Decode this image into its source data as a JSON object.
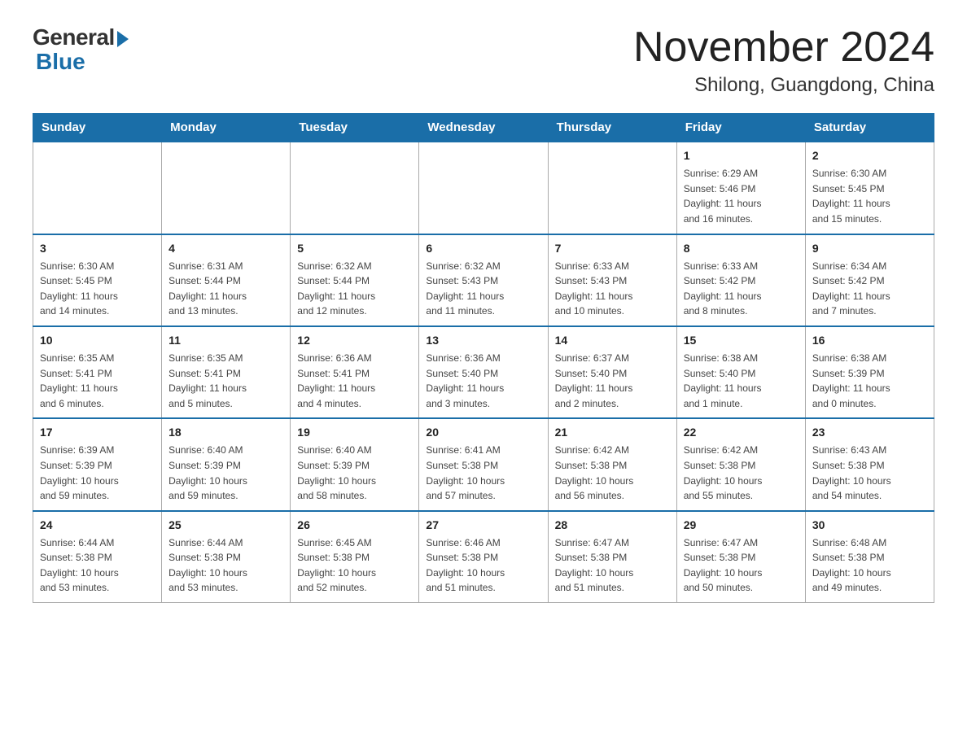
{
  "header": {
    "logo_general": "General",
    "logo_blue": "Blue",
    "month_title": "November 2024",
    "location": "Shilong, Guangdong, China"
  },
  "weekdays": [
    "Sunday",
    "Monday",
    "Tuesday",
    "Wednesday",
    "Thursday",
    "Friday",
    "Saturday"
  ],
  "weeks": [
    [
      {
        "day": "",
        "info": ""
      },
      {
        "day": "",
        "info": ""
      },
      {
        "day": "",
        "info": ""
      },
      {
        "day": "",
        "info": ""
      },
      {
        "day": "",
        "info": ""
      },
      {
        "day": "1",
        "info": "Sunrise: 6:29 AM\nSunset: 5:46 PM\nDaylight: 11 hours\nand 16 minutes."
      },
      {
        "day": "2",
        "info": "Sunrise: 6:30 AM\nSunset: 5:45 PM\nDaylight: 11 hours\nand 15 minutes."
      }
    ],
    [
      {
        "day": "3",
        "info": "Sunrise: 6:30 AM\nSunset: 5:45 PM\nDaylight: 11 hours\nand 14 minutes."
      },
      {
        "day": "4",
        "info": "Sunrise: 6:31 AM\nSunset: 5:44 PM\nDaylight: 11 hours\nand 13 minutes."
      },
      {
        "day": "5",
        "info": "Sunrise: 6:32 AM\nSunset: 5:44 PM\nDaylight: 11 hours\nand 12 minutes."
      },
      {
        "day": "6",
        "info": "Sunrise: 6:32 AM\nSunset: 5:43 PM\nDaylight: 11 hours\nand 11 minutes."
      },
      {
        "day": "7",
        "info": "Sunrise: 6:33 AM\nSunset: 5:43 PM\nDaylight: 11 hours\nand 10 minutes."
      },
      {
        "day": "8",
        "info": "Sunrise: 6:33 AM\nSunset: 5:42 PM\nDaylight: 11 hours\nand 8 minutes."
      },
      {
        "day": "9",
        "info": "Sunrise: 6:34 AM\nSunset: 5:42 PM\nDaylight: 11 hours\nand 7 minutes."
      }
    ],
    [
      {
        "day": "10",
        "info": "Sunrise: 6:35 AM\nSunset: 5:41 PM\nDaylight: 11 hours\nand 6 minutes."
      },
      {
        "day": "11",
        "info": "Sunrise: 6:35 AM\nSunset: 5:41 PM\nDaylight: 11 hours\nand 5 minutes."
      },
      {
        "day": "12",
        "info": "Sunrise: 6:36 AM\nSunset: 5:41 PM\nDaylight: 11 hours\nand 4 minutes."
      },
      {
        "day": "13",
        "info": "Sunrise: 6:36 AM\nSunset: 5:40 PM\nDaylight: 11 hours\nand 3 minutes."
      },
      {
        "day": "14",
        "info": "Sunrise: 6:37 AM\nSunset: 5:40 PM\nDaylight: 11 hours\nand 2 minutes."
      },
      {
        "day": "15",
        "info": "Sunrise: 6:38 AM\nSunset: 5:40 PM\nDaylight: 11 hours\nand 1 minute."
      },
      {
        "day": "16",
        "info": "Sunrise: 6:38 AM\nSunset: 5:39 PM\nDaylight: 11 hours\nand 0 minutes."
      }
    ],
    [
      {
        "day": "17",
        "info": "Sunrise: 6:39 AM\nSunset: 5:39 PM\nDaylight: 10 hours\nand 59 minutes."
      },
      {
        "day": "18",
        "info": "Sunrise: 6:40 AM\nSunset: 5:39 PM\nDaylight: 10 hours\nand 59 minutes."
      },
      {
        "day": "19",
        "info": "Sunrise: 6:40 AM\nSunset: 5:39 PM\nDaylight: 10 hours\nand 58 minutes."
      },
      {
        "day": "20",
        "info": "Sunrise: 6:41 AM\nSunset: 5:38 PM\nDaylight: 10 hours\nand 57 minutes."
      },
      {
        "day": "21",
        "info": "Sunrise: 6:42 AM\nSunset: 5:38 PM\nDaylight: 10 hours\nand 56 minutes."
      },
      {
        "day": "22",
        "info": "Sunrise: 6:42 AM\nSunset: 5:38 PM\nDaylight: 10 hours\nand 55 minutes."
      },
      {
        "day": "23",
        "info": "Sunrise: 6:43 AM\nSunset: 5:38 PM\nDaylight: 10 hours\nand 54 minutes."
      }
    ],
    [
      {
        "day": "24",
        "info": "Sunrise: 6:44 AM\nSunset: 5:38 PM\nDaylight: 10 hours\nand 53 minutes."
      },
      {
        "day": "25",
        "info": "Sunrise: 6:44 AM\nSunset: 5:38 PM\nDaylight: 10 hours\nand 53 minutes."
      },
      {
        "day": "26",
        "info": "Sunrise: 6:45 AM\nSunset: 5:38 PM\nDaylight: 10 hours\nand 52 minutes."
      },
      {
        "day": "27",
        "info": "Sunrise: 6:46 AM\nSunset: 5:38 PM\nDaylight: 10 hours\nand 51 minutes."
      },
      {
        "day": "28",
        "info": "Sunrise: 6:47 AM\nSunset: 5:38 PM\nDaylight: 10 hours\nand 51 minutes."
      },
      {
        "day": "29",
        "info": "Sunrise: 6:47 AM\nSunset: 5:38 PM\nDaylight: 10 hours\nand 50 minutes."
      },
      {
        "day": "30",
        "info": "Sunrise: 6:48 AM\nSunset: 5:38 PM\nDaylight: 10 hours\nand 49 minutes."
      }
    ]
  ]
}
